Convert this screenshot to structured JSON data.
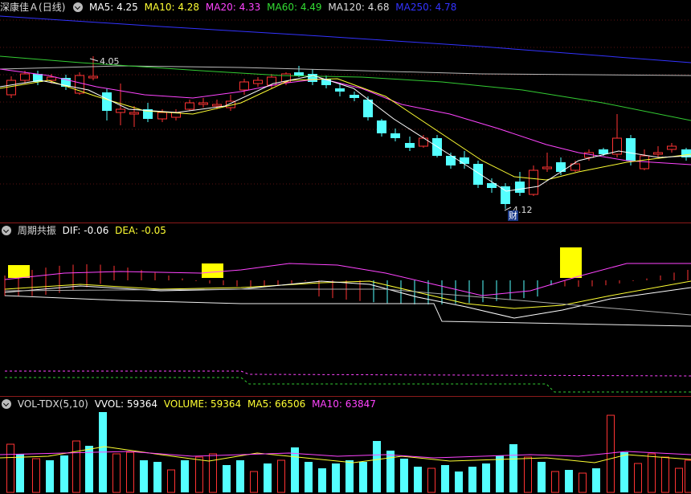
{
  "price_panel": {
    "title": "深康佳Ａ",
    "period": "(日线)",
    "indicators": [
      {
        "label": "MA5: 4.25",
        "color": "#ffffff"
      },
      {
        "label": "MA10: 4.28",
        "color": "#ffff33"
      },
      {
        "label": "MA20: 4.33",
        "color": "#ff44ff"
      },
      {
        "label": "MA60: 4.49",
        "color": "#33dd33"
      },
      {
        "label": "MA120: 4.68",
        "color": "#dddddd"
      },
      {
        "label": "MA250: 4.78",
        "color": "#3333ff"
      }
    ],
    "high_label": "4.05",
    "low_label": "4.12",
    "event_badge": "财"
  },
  "macd_panel": {
    "title": "周期共振",
    "dif": "DIF: -0.06",
    "dea": "DEA: -0.05"
  },
  "volume_panel": {
    "title": "VOL-TDX(5,10)",
    "vvol": "VVOL: 59364",
    "volume": "VOLUME: 59364",
    "ma5": "MA5: 66506",
    "ma10": "MA10: 63847"
  },
  "colors": {
    "up": "#ff3333",
    "down": "#54ffff",
    "separator": "#8b1a1a",
    "macd_yellow_block": "#ffff00"
  }
}
